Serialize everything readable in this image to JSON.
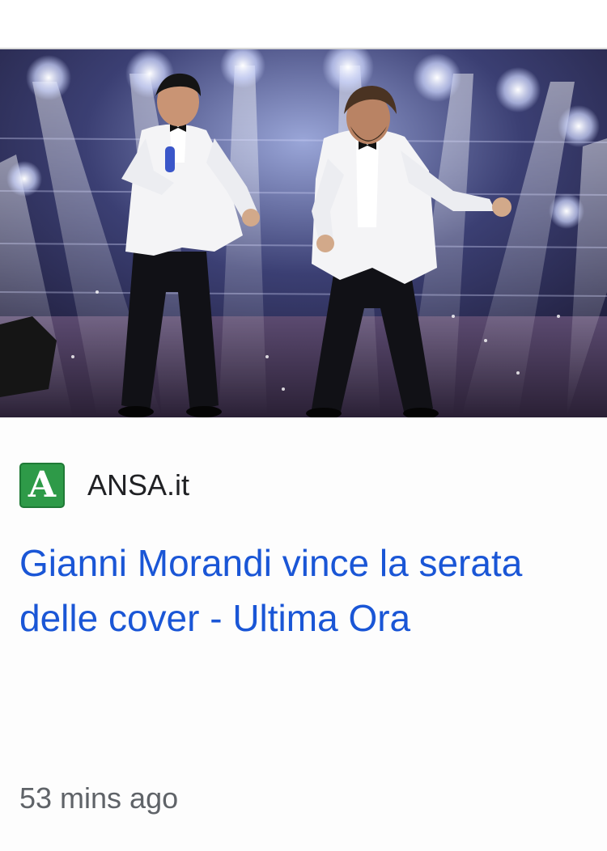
{
  "article": {
    "image_alt": "Two performers in white dinner jackets and black bow ties dancing on a stage lit by spotlights",
    "source": {
      "logo_letter": "A",
      "name": "ANSA.it",
      "brand_color": "#2e9a48"
    },
    "headline": "Gianni Morandi vince la serata delle cover - Ultima Ora",
    "timestamp": "53 mins ago"
  },
  "colors": {
    "headline": "#1a56d6",
    "timestamp": "#5f6368",
    "source_text": "#202124"
  }
}
